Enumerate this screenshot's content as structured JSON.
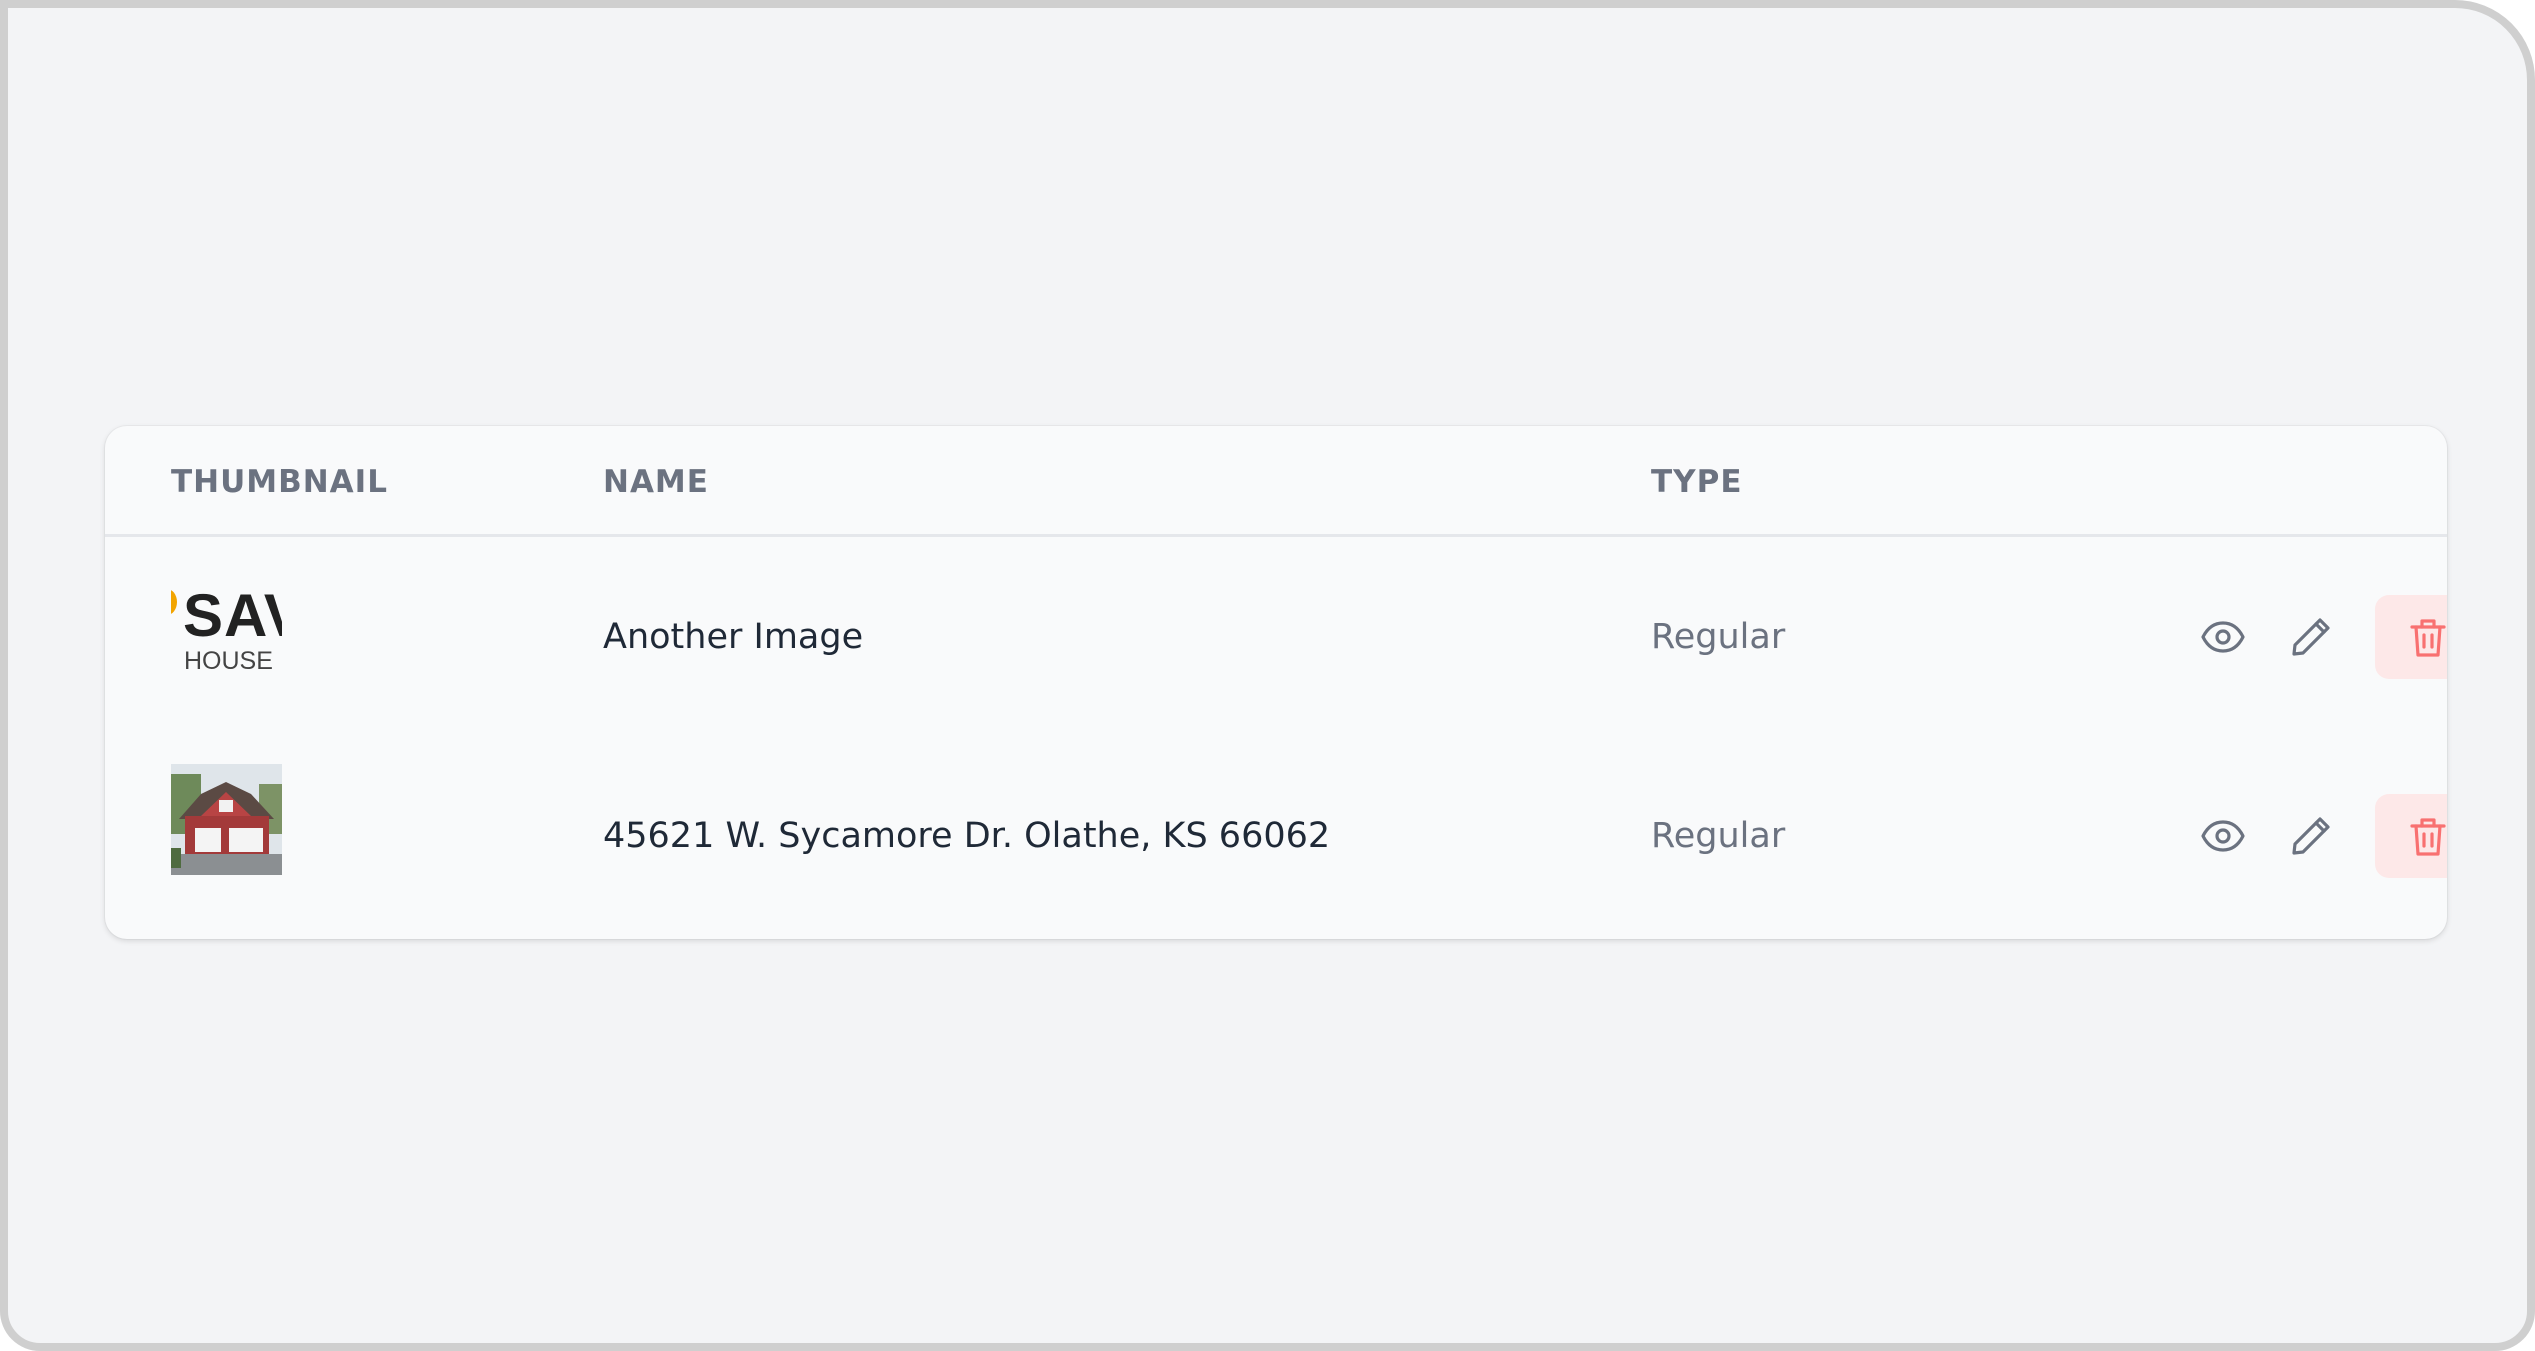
{
  "table": {
    "headers": {
      "thumbnail": "THUMBNAIL",
      "name": "NAME",
      "type": "TYPE"
    },
    "rows": [
      {
        "thumbnail": {
          "kind": "logo",
          "logo_text": "SAV",
          "logo_subtext": "HOUSE"
        },
        "name": "Another Image",
        "type": "Regular",
        "actions": [
          "eye-icon",
          "pencil-icon",
          "trash-icon"
        ]
      },
      {
        "thumbnail": {
          "kind": "photo",
          "subject": "house-photo"
        },
        "name": "45621 W. Sycamore Dr. Olathe, KS 66062",
        "type": "Regular",
        "actions": [
          "eye-icon",
          "pencil-icon",
          "trash-icon"
        ]
      }
    ]
  },
  "colors": {
    "page_background": "#f3f4f6",
    "card_background": "#f9fafb",
    "header_text": "#6b7280",
    "name_text": "#1f2937",
    "type_text": "#6b7280",
    "action_icon": "#6b7280",
    "delete_icon": "#f87171",
    "delete_background": "#fde8e8"
  }
}
